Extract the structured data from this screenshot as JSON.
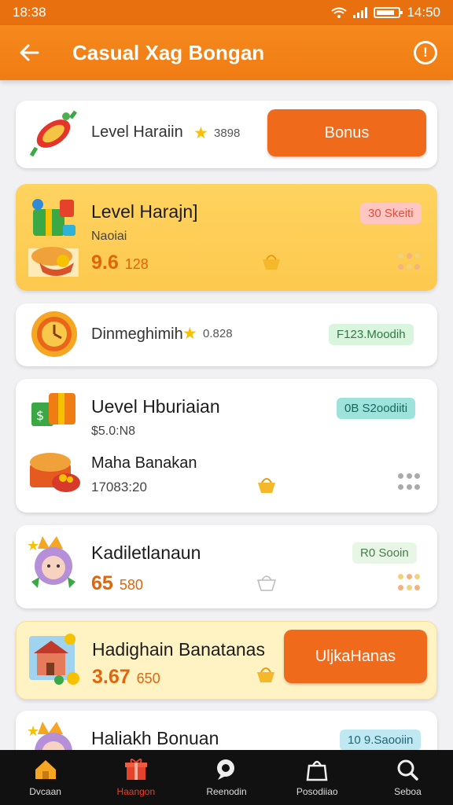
{
  "status_bar": {
    "time": "18:38",
    "battery_time": "14:50"
  },
  "header": {
    "title": "Casual Xag Bongan",
    "back_icon": "arrow-left-icon",
    "info_icon": "exclamation-circle-icon"
  },
  "cards": [
    {
      "title": "Level Haraiin",
      "star_value": "3898",
      "button": "Bonus"
    },
    {
      "title": "Level Harajn]",
      "subtitle": "Naoiai",
      "score_big": "9.6",
      "score_small": "128",
      "badge": "30 Skeiti"
    },
    {
      "title": "Dinmeghimih",
      "star_value": "0.828",
      "badge": "F123.Moodih"
    },
    {
      "title": "Uevel Hburiaian",
      "subtitle": "$5.0:N8",
      "badge": "0B S2oodiiti",
      "title2": "Maha Banakan",
      "subtitle2": "17083:20"
    },
    {
      "title": "Kadiletlanaun",
      "score_big": "65",
      "score_small": "580",
      "badge": "R0 Sooin"
    },
    {
      "title": "Hadighain Banatanas",
      "score_big": "3.67",
      "score_small": "650",
      "button": "UljkaHanas"
    },
    {
      "title": "Haliakh Bonuan",
      "badge": "10 9.Saooiin"
    }
  ],
  "nav": [
    {
      "label": "Dvcaan",
      "icon": "home-icon",
      "color": "#f5a623"
    },
    {
      "label": "Haangon",
      "icon": "gift-icon",
      "color": "#e5412b"
    },
    {
      "label": "Reenodin",
      "icon": "chat-icon",
      "color": "#eeeeee"
    },
    {
      "label": "Posodiiao",
      "icon": "bag-icon",
      "color": "#eeeeee"
    },
    {
      "label": "Seboa",
      "icon": "search-icon",
      "color": "#eeeeee"
    }
  ],
  "colors": {
    "primary": "#f07c14",
    "accent_button": "#f06a1c",
    "highlight_card": "#fdc94e"
  }
}
